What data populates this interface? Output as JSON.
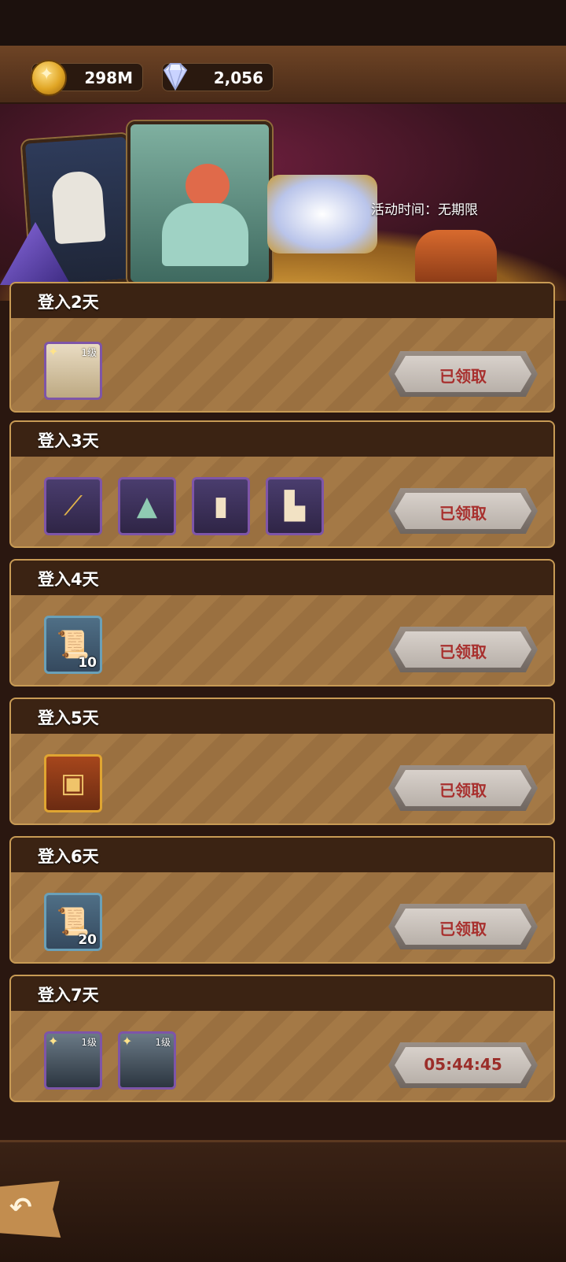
{
  "currency": {
    "gold": "298M",
    "diamond": "2,056"
  },
  "banner": {
    "event_time": "活动时间：无期限"
  },
  "days": [
    {
      "title": "登入2天",
      "button": "已领取",
      "items": [
        {
          "icon": "hero-portrait-icon",
          "level": "1级"
        }
      ]
    },
    {
      "title": "登入3天",
      "button": "已领取",
      "items": [
        {
          "icon": "staff-icon"
        },
        {
          "icon": "hat-icon"
        },
        {
          "icon": "robe-icon"
        },
        {
          "icon": "boots-icon"
        }
      ]
    },
    {
      "title": "登入4天",
      "button": "已领取",
      "items": [
        {
          "icon": "scroll-icon",
          "qty": "10"
        }
      ]
    },
    {
      "title": "登入5天",
      "button": "已领取",
      "items": [
        {
          "icon": "chest-icon"
        }
      ]
    },
    {
      "title": "登入6天",
      "button": "已领取",
      "items": [
        {
          "icon": "scroll-icon",
          "qty": "20"
        }
      ]
    },
    {
      "title": "登入7天",
      "button": "05:44:45",
      "items": [
        {
          "icon": "hero-portrait-icon",
          "level": "1级"
        },
        {
          "icon": "hero-portrait-icon",
          "level": "1级"
        }
      ]
    }
  ]
}
